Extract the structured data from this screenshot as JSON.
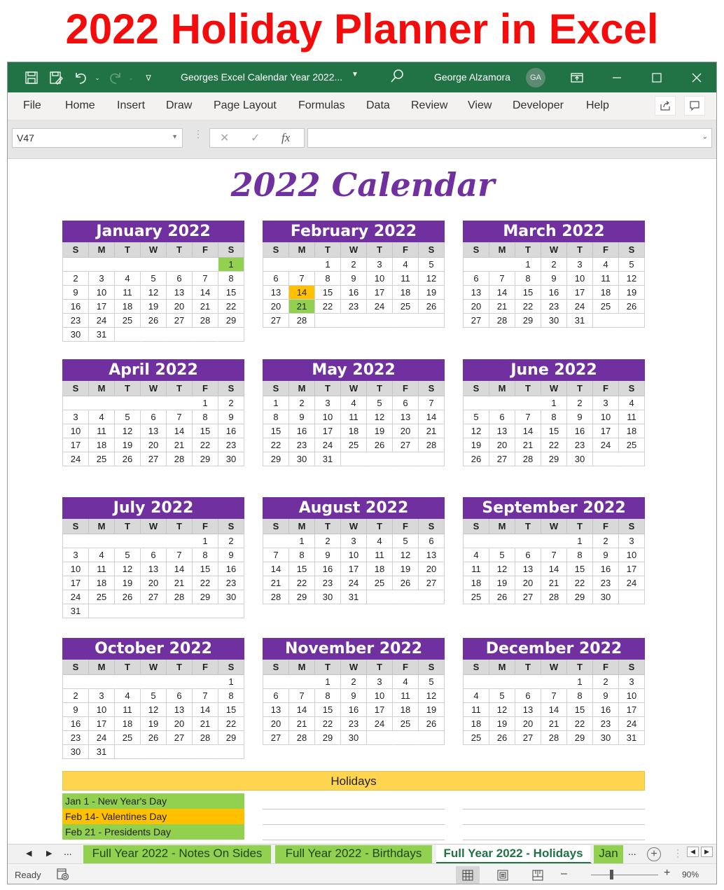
{
  "banner": {
    "title": "2022 Holiday Planner in Excel"
  },
  "titlebar": {
    "doc_title": "Georges Excel Calendar Year 2022...",
    "user_name": "George Alzamora",
    "user_initials": "GA"
  },
  "ribbon": {
    "tabs": [
      "File",
      "Home",
      "Insert",
      "Draw",
      "Page Layout",
      "Formulas",
      "Data",
      "Review",
      "View",
      "Developer",
      "Help"
    ]
  },
  "formula_bar": {
    "name_box": "V47",
    "formula_value": "",
    "fx_label": "fx"
  },
  "sheet": {
    "title": "2022 Calendar",
    "weekday_headers": [
      "S",
      "M",
      "T",
      "W",
      "T",
      "F",
      "S"
    ],
    "months": [
      {
        "name": "January 2022",
        "start": 6,
        "days": 31,
        "highlights": {
          "1": "green"
        }
      },
      {
        "name": "February 2022",
        "start": 2,
        "days": 28,
        "highlights": {
          "14": "orange",
          "21": "green"
        }
      },
      {
        "name": "March 2022",
        "start": 2,
        "days": 31,
        "highlights": {}
      },
      {
        "name": "April 2022",
        "start": 5,
        "days": 30,
        "highlights": {}
      },
      {
        "name": "May 2022",
        "start": 0,
        "days": 31,
        "highlights": {}
      },
      {
        "name": "June 2022",
        "start": 3,
        "days": 30,
        "highlights": {}
      },
      {
        "name": "July 2022",
        "start": 5,
        "days": 31,
        "highlights": {}
      },
      {
        "name": "August 2022",
        "start": 1,
        "days": 31,
        "highlights": {}
      },
      {
        "name": "September 2022",
        "start": 4,
        "days": 30,
        "highlights": {}
      },
      {
        "name": "October 2022",
        "start": 6,
        "days": 31,
        "highlights": {}
      },
      {
        "name": "November 2022",
        "start": 2,
        "days": 30,
        "highlights": {}
      },
      {
        "name": "December 2022",
        "start": 4,
        "days": 31,
        "highlights": {}
      }
    ],
    "holidays_header": "Holidays",
    "holidays": [
      {
        "label": "Jan 1 - New Year's Day",
        "color": "#92d050"
      },
      {
        "label": "Feb 14- Valentines Day",
        "color": "#ffc000"
      },
      {
        "label": "Feb 21 - Presidents Day",
        "color": "#92d050"
      }
    ]
  },
  "sheet_tabs": {
    "tabs": [
      {
        "label": "Full Year 2022 - Notes On Sides",
        "active": false
      },
      {
        "label": "Full Year 2022 - Birthdays",
        "active": false
      },
      {
        "label": "Full Year 2022 - Holidays",
        "active": true
      },
      {
        "label": "Jan",
        "active": false
      }
    ],
    "more_label": "..."
  },
  "status_bar": {
    "status": "Ready",
    "zoom_level": "90%",
    "zoom_percent": 90
  },
  "colors": {
    "excel_green": "#217346",
    "month_header_purple": "#7030a0",
    "holiday_green": "#92d050",
    "holiday_orange": "#ffc000",
    "holidays_header_yellow": "#ffd44f",
    "banner_red": "#f40c0c"
  }
}
